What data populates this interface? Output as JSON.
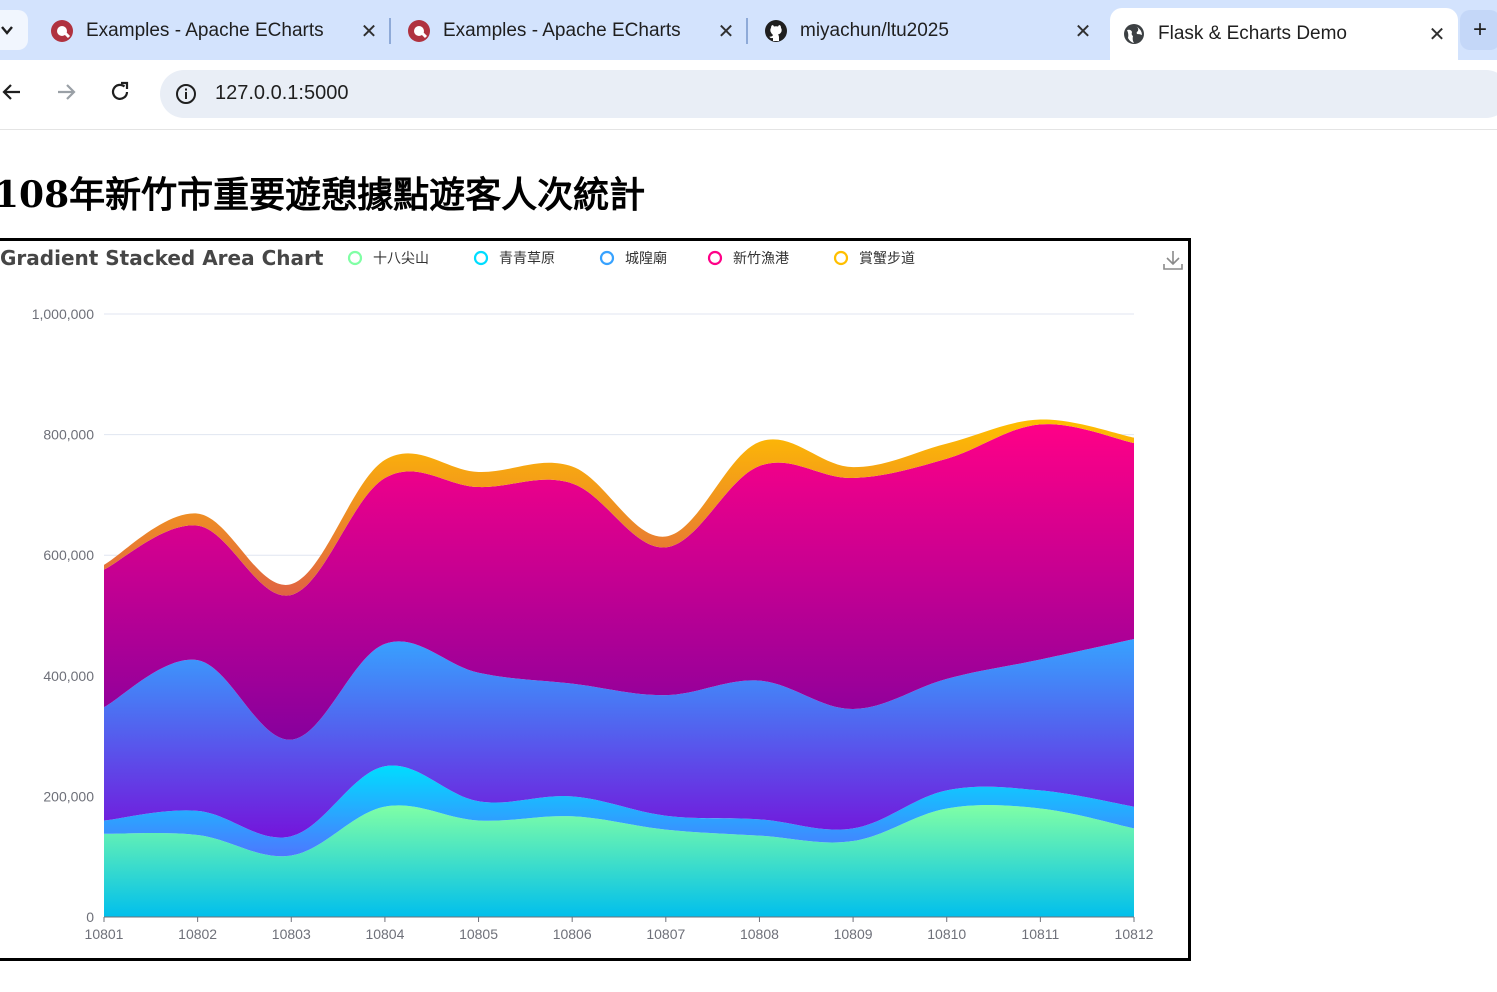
{
  "browser": {
    "tabs": [
      {
        "title": "Examples - Apache ECharts",
        "icon": "echarts-icon",
        "active": false
      },
      {
        "title": "Examples - Apache ECharts",
        "icon": "echarts-icon",
        "active": false
      },
      {
        "title": "miyachun/ltu2025",
        "icon": "github-icon",
        "active": false
      },
      {
        "title": "Flask & Echarts Demo",
        "icon": "globe-icon",
        "active": true
      }
    ],
    "close_glyph": "✕",
    "new_tab_glyph": "+",
    "url": "127.0.0.1:5000"
  },
  "page": {
    "heading": "108年新竹市重要遊憩據點遊客人次統計"
  },
  "chart_data": {
    "type": "area",
    "stacked": true,
    "smooth": true,
    "title": "Gradient Stacked Area Chart",
    "categories": [
      "10801",
      "10802",
      "10803",
      "10804",
      "10805",
      "10806",
      "10807",
      "10808",
      "10809",
      "10810",
      "10811",
      "10812"
    ],
    "series": [
      {
        "name": "十八尖山",
        "values": [
          138000,
          136000,
          102000,
          183000,
          160000,
          167000,
          145000,
          135000,
          126000,
          180000,
          180000,
          147000
        ],
        "legend_color": "#80FFA5",
        "gradient": [
          "#80FFA5",
          "#01BFEC"
        ]
      },
      {
        "name": "青青草原",
        "values": [
          22000,
          40000,
          32000,
          67000,
          32000,
          33000,
          23000,
          27000,
          21000,
          30000,
          30000,
          36000
        ],
        "legend_color": "#00DDFF",
        "gradient": [
          "#00DDFF",
          "#4D77FF"
        ]
      },
      {
        "name": "城隍廟",
        "values": [
          188000,
          250000,
          160000,
          203000,
          213000,
          187000,
          200000,
          230000,
          198000,
          185000,
          217000,
          278000
        ],
        "legend_color": "#37A2FF",
        "gradient": [
          "#37A2FF",
          "#7415DB"
        ]
      },
      {
        "name": "新竹漁港",
        "values": [
          228000,
          223000,
          240000,
          275000,
          308000,
          332000,
          245000,
          356000,
          383000,
          365000,
          390000,
          325000
        ],
        "legend_color": "#FF0087",
        "gradient": [
          "#FF0087",
          "#87009D"
        ]
      },
      {
        "name": "賞蟹步道",
        "values": [
          8000,
          20000,
          18000,
          30000,
          25000,
          28000,
          18000,
          40000,
          18000,
          25000,
          8000,
          9000
        ],
        "legend_color": "#FFBF00",
        "gradient": [
          "#FFBF00",
          "#E06343"
        ]
      }
    ],
    "y_ticks": [
      "0",
      "200,000",
      "400,000",
      "600,000",
      "800,000",
      "1,000,000"
    ],
    "ylim": [
      0,
      1000000
    ],
    "grid": true,
    "legend_position": "top"
  }
}
